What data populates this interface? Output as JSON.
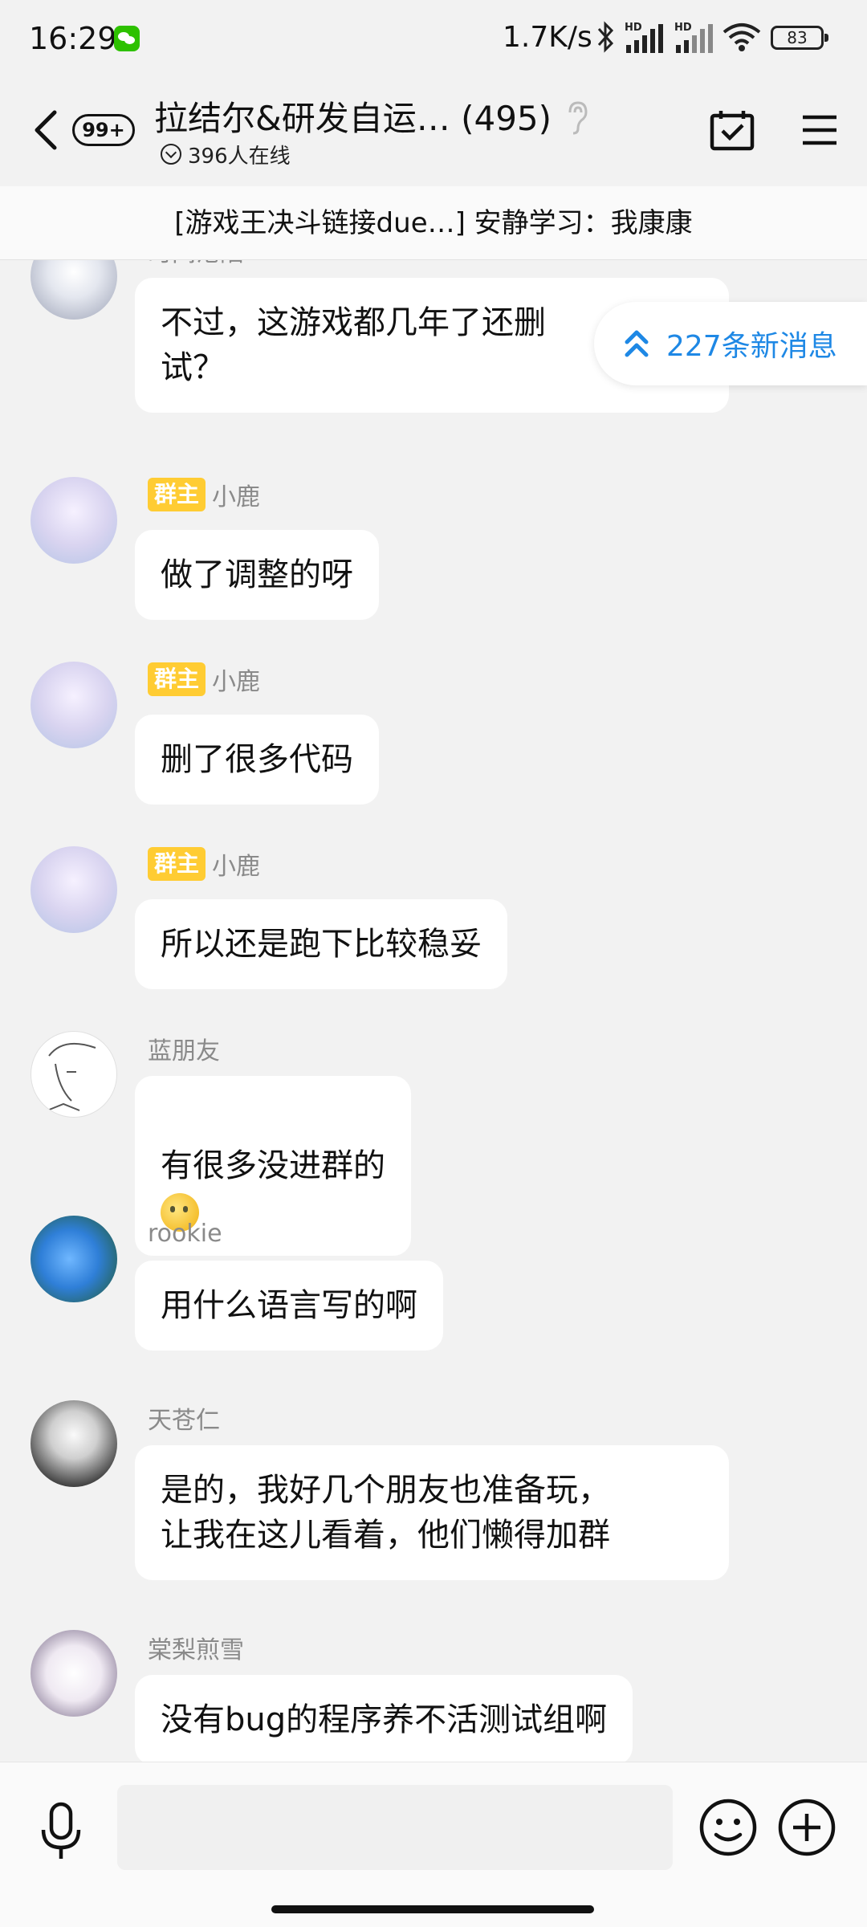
{
  "status_bar": {
    "time": "16:29",
    "network_speed": "1.7K/s",
    "signal_label_1": "HD",
    "signal_label_2": "HD",
    "battery": "83"
  },
  "header": {
    "unread_count": "99+",
    "group_title": "拉结尔&研发自运… (495)",
    "online_text": "396人在线"
  },
  "pinned_message": "[游戏王决斗链接due…] 安静学习：我康康",
  "new_messages_label": "227条新消息",
  "messages": [
    {
      "sender": "时间沦陷",
      "owner": false,
      "text": "不过，这游戏都几年了还删\n试？"
    },
    {
      "sender": "小鹿",
      "owner": true,
      "badge": "群主",
      "text": "做了调整的呀"
    },
    {
      "sender": "小鹿",
      "owner": true,
      "badge": "群主",
      "text": "删了很多代码"
    },
    {
      "sender": "小鹿",
      "owner": true,
      "badge": "群主",
      "text": "所以还是跑下比较稳妥"
    },
    {
      "sender": "蓝朋友",
      "owner": false,
      "text": "有很多没进群的"
    },
    {
      "sender": "rookie",
      "owner": false,
      "text": "用什么语言写的啊"
    },
    {
      "sender": "天苍仁",
      "owner": false,
      "text": "是的，我好几个朋友也准备玩，\n让我在这儿看着，他们懒得加群"
    },
    {
      "sender": "棠梨煎雪",
      "owner": false,
      "text": "没有bug的程序养不活测试组啊"
    }
  ],
  "input": {
    "placeholder": ""
  },
  "colors": {
    "accent": "#1e88e5",
    "owner_badge": "#ffcc33",
    "background": "#f2f2f2"
  },
  "icons": [
    "back-arrow-icon",
    "ear-icon",
    "calendar-check-icon",
    "menu-icon",
    "double-chevron-up-icon",
    "microphone-icon",
    "emoji-icon",
    "plus-icon"
  ]
}
